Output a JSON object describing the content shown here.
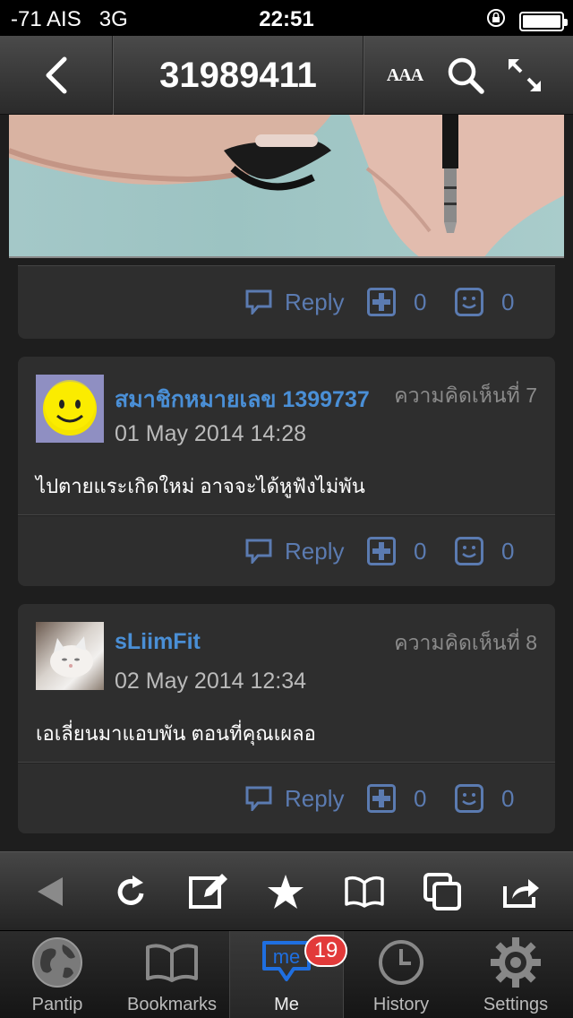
{
  "status_bar": {
    "carrier": "-71 AIS",
    "network": "3G",
    "time": "22:51"
  },
  "nav": {
    "title": "31989411",
    "font_size_icon": "AAA"
  },
  "comments": [
    {
      "author": "สมาชิกหมายเลข 1399737",
      "comment_no": "ความคิดเห็นที่ 7",
      "date": "01 May 2014 14:28",
      "body": "ไปตายแระเกิดใหม่ อาจจะได้หูฟังไม่พัน",
      "reply": "Reply",
      "plus_count": "0",
      "emotion_count": "0"
    },
    {
      "author": "sLiimFit",
      "comment_no": "ความคิดเห็นที่ 8",
      "date": "02 May 2014 12:34",
      "body": "เอเลี่ยนมาแอบพัน ตอนที่คุณเผลอ",
      "reply": "Reply",
      "plus_count": "0",
      "emotion_count": "0"
    }
  ],
  "previous_card": {
    "reply": "Reply",
    "plus_count": "0",
    "emotion_count": "0"
  },
  "tabs": [
    {
      "label": "Pantip",
      "icon": "globe-icon"
    },
    {
      "label": "Bookmarks",
      "icon": "book-icon"
    },
    {
      "label": "Me",
      "icon": "me-icon",
      "badge": "19",
      "active": true
    },
    {
      "label": "History",
      "icon": "clock-icon"
    },
    {
      "label": "Settings",
      "icon": "gear-icon"
    }
  ],
  "colors": {
    "accent": "#4a8fd6",
    "action": "#5b7bb1",
    "badge": "#e23a3a"
  }
}
